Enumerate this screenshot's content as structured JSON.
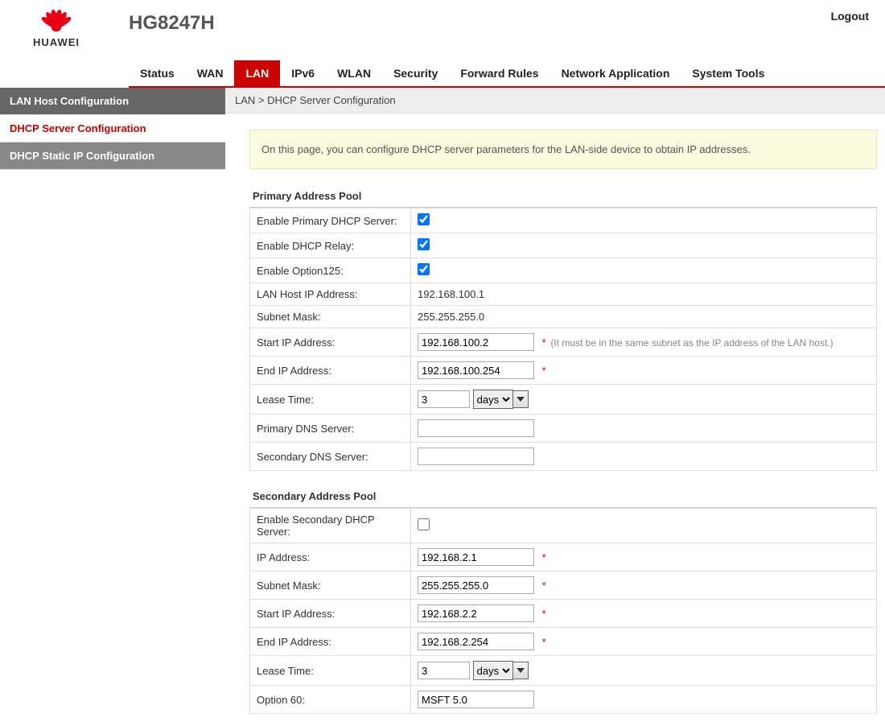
{
  "brand": {
    "name": "HUAWEI",
    "model": "HG8247H"
  },
  "logout": "Logout",
  "tabs": {
    "status": "Status",
    "wan": "WAN",
    "lan": "LAN",
    "ipv6": "IPv6",
    "wlan": "WLAN",
    "security": "Security",
    "forward": "Forward Rules",
    "netapp": "Network Application",
    "systools": "System Tools"
  },
  "sidebar": {
    "lanhost": "LAN Host Configuration",
    "dhcpserver": "DHCP Server Configuration",
    "dhcpstatic": "DHCP Static IP Configuration"
  },
  "breadcrumb": "LAN > DHCP Server Configuration",
  "info": "On this page, you can configure DHCP server parameters for the LAN-side device to obtain IP addresses.",
  "primary": {
    "title": "Primary Address Pool",
    "labels": {
      "enable_primary": "Enable Primary DHCP Server:",
      "enable_relay": "Enable DHCP Relay:",
      "enable_opt125": "Enable Option125:",
      "lan_host_ip": "LAN Host IP Address:",
      "subnet": "Subnet Mask:",
      "start_ip": "Start IP Address:",
      "end_ip": "End IP Address:",
      "lease": "Lease Time:",
      "pri_dns": "Primary DNS Server:",
      "sec_dns": "Secondary DNS Server:"
    },
    "values": {
      "lan_host_ip": "192.168.100.1",
      "subnet": "255.255.255.0",
      "start_ip": "192.168.100.2",
      "end_ip": "192.168.100.254",
      "lease_num": "3",
      "lease_unit": "days",
      "pri_dns": "",
      "sec_dns": ""
    },
    "hints": {
      "start_ip": "(It must be in the same subnet as the IP address of the LAN host.)"
    }
  },
  "secondary": {
    "title": "Secondary Address Pool",
    "labels": {
      "enable_secondary": "Enable Secondary DHCP Server:",
      "ip": "IP Address:",
      "subnet": "Subnet Mask:",
      "start_ip": "Start IP Address:",
      "end_ip": "End IP Address:",
      "lease": "Lease Time:",
      "option60": "Option 60:"
    },
    "values": {
      "ip": "192.168.2.1",
      "subnet": "255.255.255.0",
      "start_ip": "192.168.2.2",
      "end_ip": "192.168.2.254",
      "lease_num": "3",
      "lease_unit": "days",
      "option60": "MSFT 5.0"
    }
  },
  "req_mark": "*"
}
